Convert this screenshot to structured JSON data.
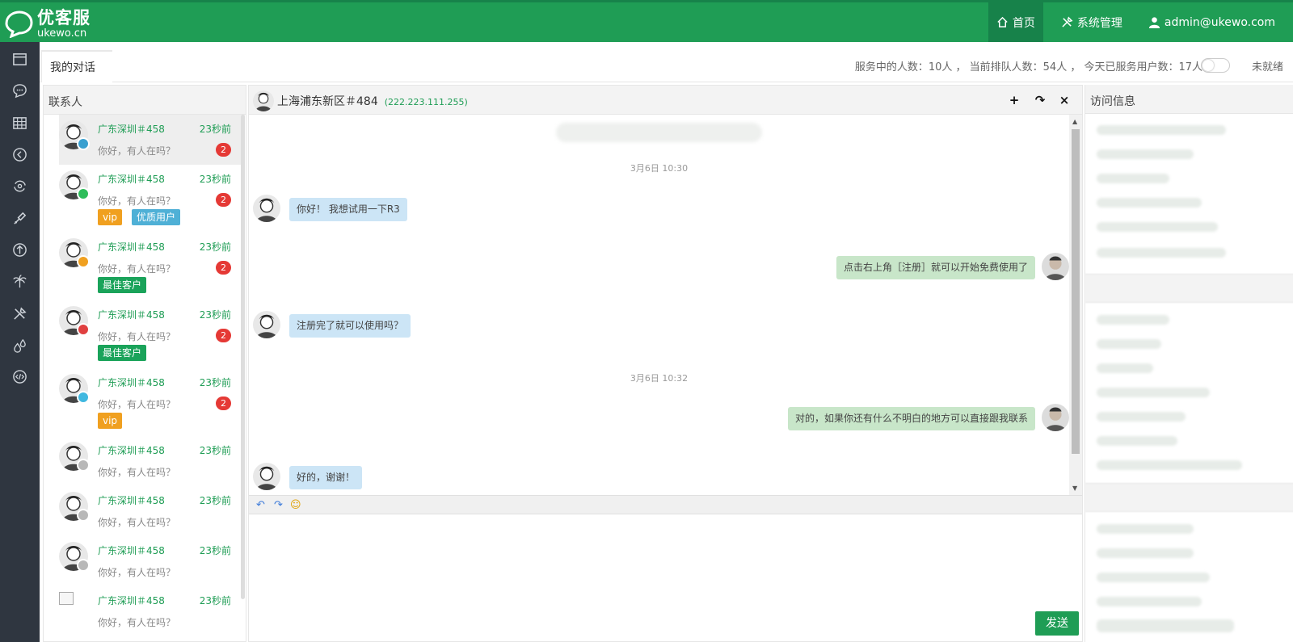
{
  "brand": {
    "name": "优客服",
    "url": "ukewo.cn"
  },
  "topnav": {
    "home": "首页",
    "system": "系统管理",
    "user": "admin@ukewo.com"
  },
  "leftbar_icons": [
    "window-icon",
    "chat-icon",
    "grid-icon",
    "back-circle-icon",
    "settings-cycle-icon",
    "brush-icon",
    "upload-circle-icon",
    "palm-icon",
    "tools-icon",
    "drops-icon",
    "code-icon"
  ],
  "subheader": {
    "tab": "我的对话",
    "stats": "服务中的人数：10人 ， 当前排队人数：54人 ， 今天已服务用户数：17人",
    "status_label": "未就绪"
  },
  "contacts": {
    "title": "联系人",
    "items": [
      {
        "name": "广东深圳＃458",
        "time": "23秒前",
        "msg": "你好，有人在吗？",
        "unread": "2",
        "channel": "web",
        "tags": []
      },
      {
        "name": "广东深圳＃458",
        "time": "23秒前",
        "msg": "你好，有人在吗？",
        "unread": "2",
        "channel": "wechat",
        "tags": [
          "vip",
          "优质用户"
        ]
      },
      {
        "name": "广东深圳＃458",
        "time": "23秒前",
        "msg": "你好，有人在吗？",
        "unread": "2",
        "channel": "app",
        "tags": [
          "最佳客户"
        ]
      },
      {
        "name": "广东深圳＃458",
        "time": "23秒前",
        "msg": "你好，有人在吗？",
        "unread": "2",
        "channel": "weibo",
        "tags": [
          "最佳客户"
        ]
      },
      {
        "name": "广东深圳＃458",
        "time": "23秒前",
        "msg": "你好，有人在吗？",
        "unread": "2",
        "channel": "qq",
        "tags": [
          "vip"
        ]
      },
      {
        "name": "广东深圳＃458",
        "time": "23秒前",
        "msg": "你好，有人在吗？",
        "unread": "",
        "channel": "web-offline",
        "tags": []
      },
      {
        "name": "广东深圳＃458",
        "time": "23秒前",
        "msg": "你好，有人在吗？",
        "unread": "",
        "channel": "web-offline",
        "tags": []
      },
      {
        "name": "广东深圳＃458",
        "time": "23秒前",
        "msg": "你好，有人在吗？",
        "unread": "",
        "channel": "web-offline",
        "tags": []
      },
      {
        "name": "广东深圳＃458",
        "time": "23秒前",
        "msg": "你好，有人在吗？",
        "unread": "",
        "channel": "",
        "tags": []
      }
    ]
  },
  "chat": {
    "title": "上海浦东新区＃484",
    "ip": "(222.223.111.255)",
    "buttons": {
      "add": "+",
      "forward": "↷",
      "close": "×"
    },
    "messages": [
      {
        "type": "time",
        "text": "3月6日 10:30"
      },
      {
        "type": "in",
        "text": "你好！ 我想试用一下R3"
      },
      {
        "type": "out",
        "text": "点击右上角［注册］就可以开始免费使用了"
      },
      {
        "type": "in",
        "text": "注册完了就可以使用吗？"
      },
      {
        "type": "time",
        "text": "3月6日 10:32"
      },
      {
        "type": "out",
        "text": "对的，如果你还有什么不明白的地方可以直接跟我联系"
      },
      {
        "type": "in",
        "text": "好的，谢谢！"
      }
    ],
    "send_label": "发送"
  },
  "info": {
    "title": "访问信息"
  },
  "colors": {
    "brand": "#1f9d55",
    "vip": "#f0a020",
    "quality": "#4fb0d6",
    "best": "#1aa35a",
    "unread": "#e53935"
  }
}
